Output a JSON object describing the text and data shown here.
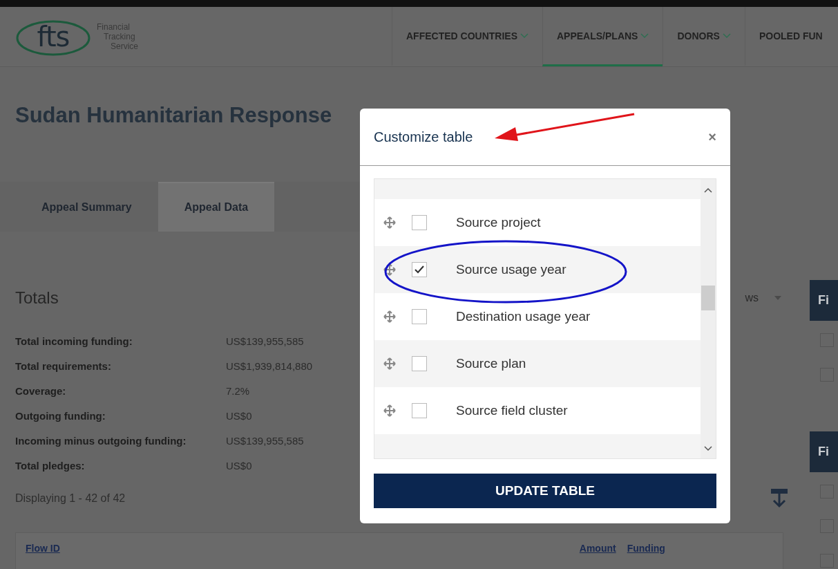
{
  "brand": {
    "logo": "fts",
    "name_lines": [
      "Financial",
      "Tracking",
      "Service"
    ]
  },
  "nav": [
    {
      "label": "AFFECTED COUNTRIES",
      "selected": false,
      "caret": true
    },
    {
      "label": "APPEALS/PLANS",
      "selected": true,
      "caret": true
    },
    {
      "label": "DONORS",
      "selected": false,
      "caret": true
    },
    {
      "label": "POOLED FUN",
      "selected": false,
      "caret": false
    }
  ],
  "page_title": "Sudan Humanitarian Response",
  "tabs": [
    {
      "label": "Appeal Summary",
      "selected": false
    },
    {
      "label": "Appeal Data",
      "selected": true
    }
  ],
  "totals": {
    "heading": "Totals",
    "rows": [
      {
        "label": "Total incoming funding:",
        "value": "US$139,955,585"
      },
      {
        "label": "Total requirements:",
        "value": "US$1,939,814,880"
      },
      {
        "label": "Coverage:",
        "value": "7.2%"
      },
      {
        "label": "Outgoing funding:",
        "value": "US$0"
      },
      {
        "label": "Incoming minus outgoing funding:",
        "value": "US$139,955,585"
      },
      {
        "label": "Total pledges:",
        "value": "US$0"
      }
    ]
  },
  "displaying": "Displaying 1 - 42 of 42",
  "rows_select": "ws",
  "table": {
    "columns": [
      "Flow ID",
      "Amount",
      "Funding"
    ]
  },
  "filters": [
    {
      "label": "Fi",
      "options": [
        {
          "checked": false
        },
        {
          "checked": false
        }
      ]
    },
    {
      "label": "Fi",
      "options": [
        {
          "checked": false
        },
        {
          "checked": false
        },
        {
          "checked": false
        }
      ]
    }
  ],
  "modal": {
    "title": "Customize table",
    "close": "×",
    "items": [
      {
        "label": "Source project",
        "checked": false
      },
      {
        "label": "Source usage year",
        "checked": true
      },
      {
        "label": "Destination usage year",
        "checked": false
      },
      {
        "label": "Source plan",
        "checked": false
      },
      {
        "label": "Source field cluster",
        "checked": false
      }
    ],
    "button": "UPDATE TABLE"
  }
}
